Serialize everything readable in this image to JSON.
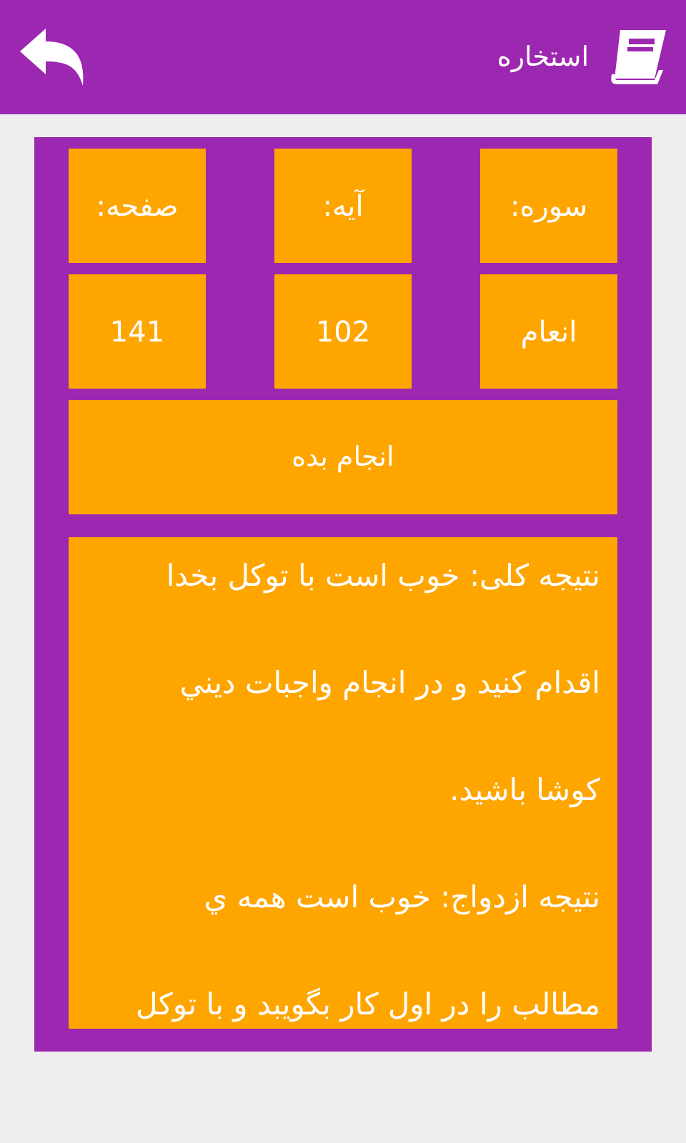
{
  "header": {
    "title": "استخاره"
  },
  "labels": [
    "سوره:",
    "آیه:",
    "صفحه:"
  ],
  "values": [
    "انعام",
    "102",
    "141"
  ],
  "action_button": "انجام بده",
  "result_lines": [
    "نتيجه کلی: خوب است با توکل بخدا",
    "اقدام کنيد و در انجام واجبات ديني",
    "کوشا باشيد.",
    "نتيجه ازدواج: خوب است همه ي",
    "مطالب را در اول کار بگويبد و با توکل"
  ]
}
